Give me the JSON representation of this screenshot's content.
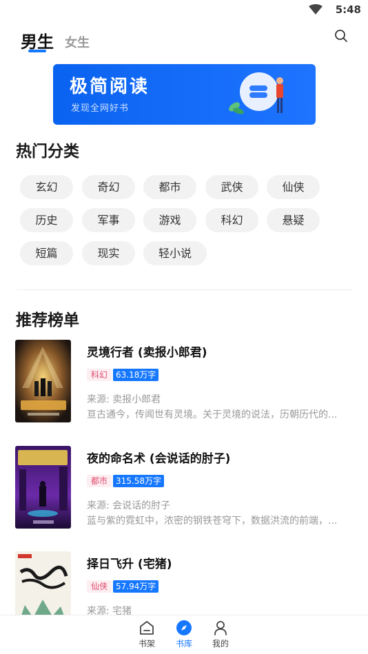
{
  "status": {
    "time": "5:48"
  },
  "tabs": [
    {
      "label": "男生",
      "active": true
    },
    {
      "label": "女生",
      "active": false
    }
  ],
  "banner": {
    "title": "极简阅读",
    "subtitle": "发现全网好书"
  },
  "sections": {
    "categories_title": "热门分类",
    "rankings_title": "推荐榜单"
  },
  "categories": [
    "玄幻",
    "奇幻",
    "都市",
    "武侠",
    "仙侠",
    "历史",
    "军事",
    "游戏",
    "科幻",
    "悬疑",
    "短篇",
    "现实",
    "轻小说"
  ],
  "books": [
    {
      "title": "灵境行者 (卖报小郎君)",
      "category": "科幻",
      "words": "63.18万字",
      "source": "来源: 卖报小郎君",
      "desc": "亘古通今，传闻世有灵境。关于灵境的说法，历朝历代的..."
    },
    {
      "title": "夜的命名术 (会说话的肘子)",
      "category": "都市",
      "words": "315.58万字",
      "source": "来源: 会说话的肘子",
      "desc": "蓝与紫的霓虹中，浓密的钢铁苍穹下，数据洪流的前端，..."
    },
    {
      "title": "择日飞升 (宅猪)",
      "category": "仙侠",
      "words": "57.94万字",
      "source": "来源: 宅猪",
      "desc": ""
    }
  ],
  "nav": [
    {
      "label": "书架",
      "icon": "bookshelf-icon",
      "active": false
    },
    {
      "label": "书库",
      "icon": "compass-icon",
      "active": true
    },
    {
      "label": "我的",
      "icon": "person-icon",
      "active": false
    }
  ],
  "colors": {
    "accent": "#1677ff",
    "tag_pink_bg": "#fdeef2",
    "tag_pink_text": "#e04d6e",
    "chip_bg": "#f2f2f2"
  }
}
